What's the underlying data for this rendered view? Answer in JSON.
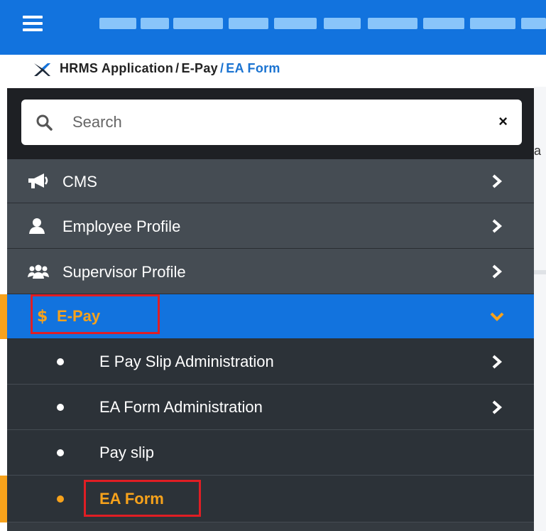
{
  "header": {
    "menu_icon": "hamburger-menu-icon",
    "title_obscured": true,
    "background_color": "#1273de"
  },
  "breadcrumb": {
    "logo_icon": "x-logo-icon",
    "items": [
      {
        "label": "HRMS Application"
      },
      {
        "label": "E-Pay"
      },
      {
        "label": "EA Form"
      }
    ],
    "separator": "/",
    "current_color": "#1a73d1"
  },
  "search": {
    "placeholder": "Search",
    "value": "",
    "clear_label": "×"
  },
  "sidebar": {
    "items": [
      {
        "label": "CMS",
        "icon": "megaphone-icon",
        "expanded": false
      },
      {
        "label": "Employee Profile",
        "icon": "user-icon",
        "expanded": false
      },
      {
        "label": "Supervisor Profile",
        "icon": "users-icon",
        "expanded": false
      },
      {
        "label": "E-Pay",
        "icon": "dollar-icon",
        "expanded": true,
        "active": true
      }
    ],
    "subitems": [
      {
        "label": "E Pay Slip Administration",
        "has_children": true
      },
      {
        "label": "EA Form Administration",
        "has_children": true
      },
      {
        "label": "Pay slip",
        "has_children": false
      },
      {
        "label": "EA Form",
        "has_children": false,
        "active": true
      }
    ]
  },
  "underlying_page": {
    "peek_text": "a"
  },
  "colors": {
    "accent": "#f7a21b",
    "active_bg": "#1273de",
    "highlight_border": "#e01e24",
    "sidebar_bg": "#454c53",
    "submenu_bg": "#2c3238"
  }
}
